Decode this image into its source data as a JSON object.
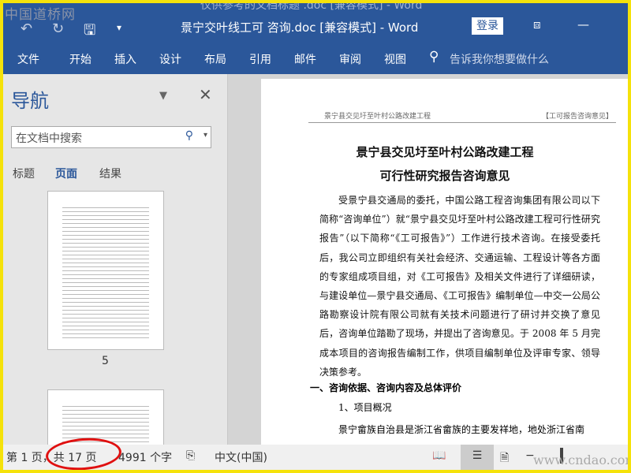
{
  "watermark_top": "中国道桥网",
  "ghost_title": "仅供参考的文档标题 .doc [兼容模式] - Word",
  "title": "景宁交叶线工可 咨询.doc [兼容模式]  -  Word",
  "login": "登录",
  "ribbon": [
    "文件",
    "开始",
    "插入",
    "设计",
    "布局",
    "引用",
    "邮件",
    "审阅",
    "视图"
  ],
  "tellme": "告诉我你想要做什么",
  "nav": {
    "title": "导航",
    "search_placeholder": "在文档中搜索",
    "tabs": [
      "标题",
      "页面",
      "结果"
    ],
    "page_label": "5"
  },
  "doc": {
    "header_left": "景宁县交见圩至叶村公路改建工程",
    "header_right": "【工可报告咨询意见】",
    "title1": "景宁县交见圩至叶村公路改建工程",
    "title2": "可行性研究报告咨询意见",
    "para": "受景宁县交通局的委托，中国公路工程咨询集团有限公司以下简称“咨询单位”）就“景宁县交见圩至叶村公路改建工程可行性研究报告”（以下简称“《工可报告》”）工作进行技术咨询。在接受委托后，我公司立即组织有关社会经济、交通运输、工程设计等各方面的专家组成项目组，对《工可报告》及相关文件进行了详细研读，与建设单位—景宁县交通局、《工可报告》编制单位—中交一公局公路勘察设计院有限公司就有关技术问题进行了研讨并交换了意见后，咨询单位踏勘了现场，并提出了咨询意见。于 2008 年 5 月完成本项目的咨询报告编制工作，供项目编制单位及评审专家、领导决策参考。",
    "section1": "一、咨询依据、咨询内容及总体评价",
    "sub1": "1、项目概况",
    "para2": "景宁畲族自治县是浙江省畲族的主要发祥地，地处浙江省南"
  },
  "status": {
    "page": "第 1 页，共 17 页",
    "words": "4991 个字",
    "lang": "中文(中国)",
    "watermark": "www.cndao.com"
  }
}
